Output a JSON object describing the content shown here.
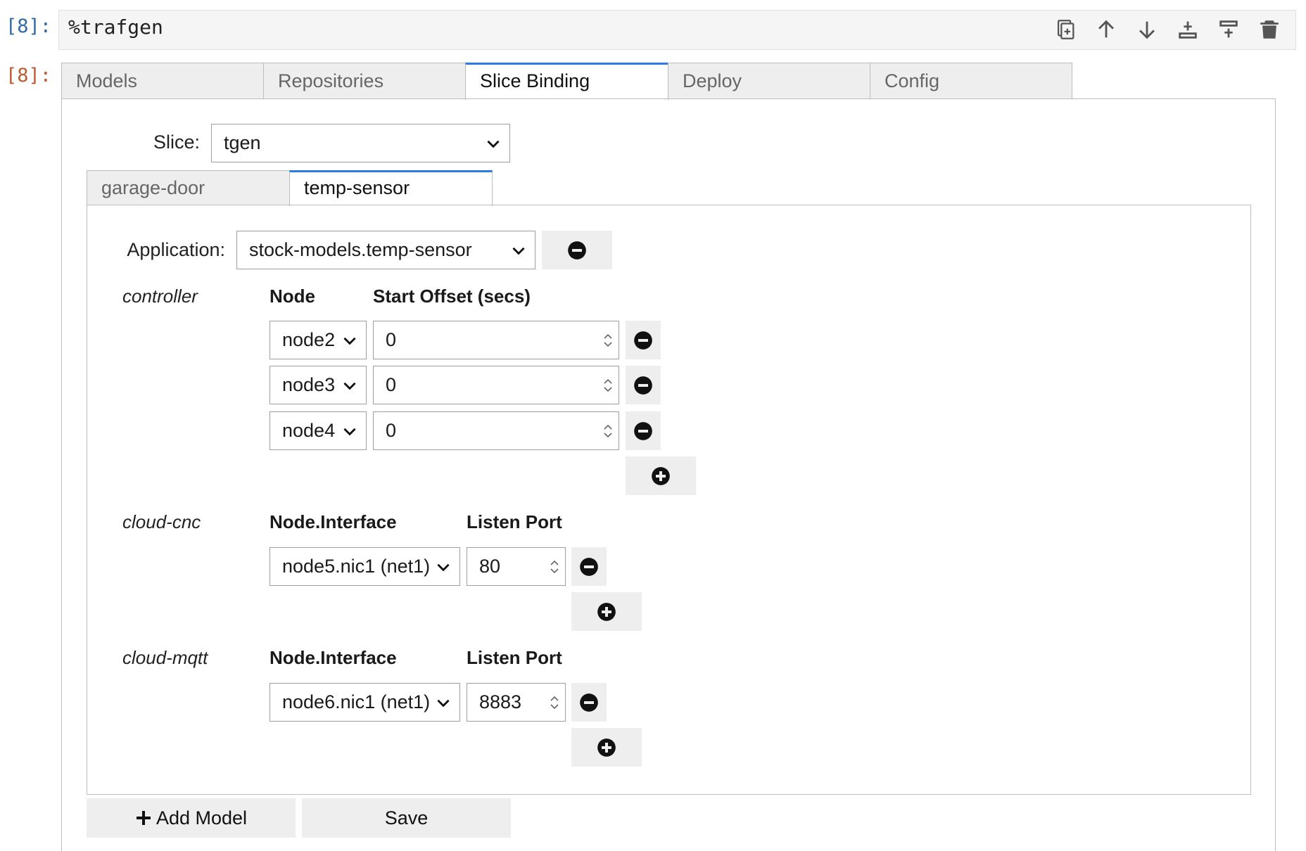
{
  "cell": {
    "input_prompt": "[8]:",
    "output_prompt": "[8]:",
    "code": "%trafgen",
    "toolbar_icons": [
      "duplicate-icon",
      "move-up-icon",
      "move-down-icon",
      "insert-below-icon",
      "insert-above-icon",
      "delete-icon"
    ]
  },
  "outer_tabs": [
    {
      "label": "Models",
      "active": false
    },
    {
      "label": "Repositories",
      "active": false
    },
    {
      "label": "Slice Binding",
      "active": true
    },
    {
      "label": "Deploy",
      "active": false
    },
    {
      "label": "Config",
      "active": false
    }
  ],
  "slice": {
    "label": "Slice:",
    "value": "tgen"
  },
  "inner_tabs": [
    {
      "label": "garage-door",
      "active": false
    },
    {
      "label": "temp-sensor",
      "active": true
    }
  ],
  "application": {
    "label": "Application:",
    "value": "stock-models.temp-sensor"
  },
  "roles": [
    {
      "name": "controller",
      "col1": "Node",
      "col2": "Start Offset (secs)",
      "rows": [
        {
          "node": "node2",
          "value": "0"
        },
        {
          "node": "node3",
          "value": "0"
        },
        {
          "node": "node4",
          "value": "0"
        }
      ]
    },
    {
      "name": "cloud-cnc",
      "col1": "Node.Interface",
      "col2": "Listen Port",
      "rows": [
        {
          "node": "node5.nic1 (net1)",
          "value": "80"
        }
      ]
    },
    {
      "name": "cloud-mqtt",
      "col1": "Node.Interface",
      "col2": "Listen Port",
      "rows": [
        {
          "node": "node6.nic1 (net1)",
          "value": "8883"
        }
      ]
    }
  ],
  "buttons": {
    "add_model": "Add Model",
    "save": "Save"
  }
}
